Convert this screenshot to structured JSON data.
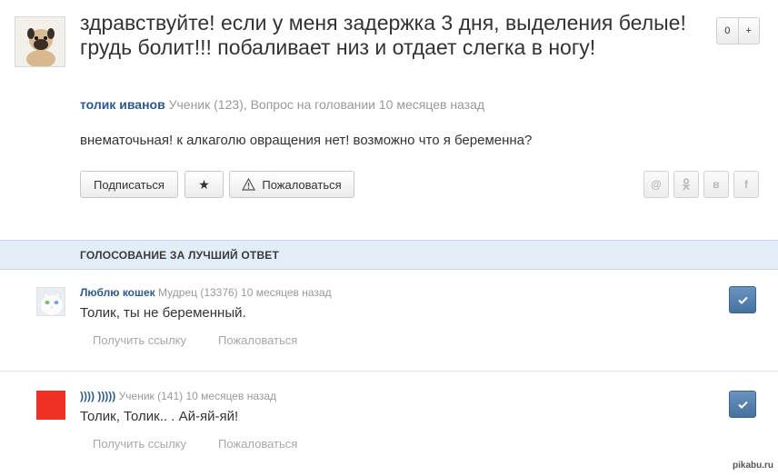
{
  "question": {
    "title": "здравствуйте! если у меня задержка 3 дня, выделения белые! грудь болит!!! побаливает низ и отдает слегка в ногу!",
    "votes": "0",
    "vote_plus": "+",
    "author": "толик иванов",
    "meta": "Ученик (123), Вопрос на головании 10 месяцев назад",
    "body": "внематочьная! к алкаголю овращения нет! возможно что я беременна?",
    "buttons": {
      "subscribe": "Подписаться",
      "star": "★",
      "report": "Пожаловаться"
    },
    "share": {
      "mail": "@",
      "ok": "ok-icon",
      "vk": "в",
      "fb": "f"
    }
  },
  "section": {
    "title": "ГОЛОСОВАНИЕ ЗА ЛУЧШИЙ ОТВЕТ"
  },
  "answers": [
    {
      "author": "Люблю кошек",
      "meta": "Мудрец (13376) 10 месяцев назад",
      "text": "Толик, ты не беременный.",
      "link_label": "Получить ссылку",
      "report_label": "Пожаловаться",
      "avatar": "white-cat-avatar"
    },
    {
      "author": ")))) )))))",
      "meta": "Ученик (141) 10 месяцев назад",
      "text": "Толик, Толик.. . Ай-яй-яй!",
      "link_label": "Получить ссылку",
      "report_label": "Пожаловаться",
      "avatar": "red-square-avatar",
      "avatar_color": "#ee3124"
    }
  ],
  "colors": {
    "link_blue": "#2e5a8a",
    "section_bg": "#e2edf8",
    "vote_button": "#4f7aa8"
  },
  "watermark": "pikabu.ru"
}
